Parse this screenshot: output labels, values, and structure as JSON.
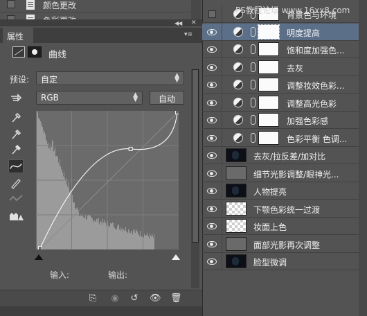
{
  "history": {
    "items": [
      {
        "label": "颜色更改"
      },
      {
        "label": "色彩更改"
      }
    ]
  },
  "properties": {
    "tab_label": "属性",
    "adjustment_title": "曲线",
    "preset_label": "预设:",
    "preset_value": "自定",
    "channel_value": "RGB",
    "auto_button": "自动",
    "input_label": "输入:",
    "output_label": "输出:"
  },
  "curve": {
    "control_points_normalized": [
      [
        0,
        0
      ],
      [
        0.66,
        0.73
      ],
      [
        1,
        1
      ]
    ],
    "histogram_note": "dark-heavy histogram"
  },
  "layers": {
    "watermark": "PS教程论坛 www.16xx8.com",
    "items": [
      {
        "name": "背景色与环境",
        "visible": false,
        "type": "adjustment"
      },
      {
        "name": "明度提高",
        "visible": true,
        "type": "adjustment",
        "selected": true
      },
      {
        "name": "饱和度加强色...",
        "visible": true,
        "type": "adjustment"
      },
      {
        "name": "去灰",
        "visible": true,
        "type": "adjustment"
      },
      {
        "name": "调整妆效色彩...",
        "visible": true,
        "type": "adjustment"
      },
      {
        "name": "调整高光色彩",
        "visible": true,
        "type": "adjustment"
      },
      {
        "name": "加强色彩感",
        "visible": true,
        "type": "adjustment"
      },
      {
        "name": "色彩平衡 色调...",
        "visible": true,
        "type": "adjustment"
      },
      {
        "name": "去灰/拉反差/加对比",
        "visible": true,
        "type": "image-dark"
      },
      {
        "name": "细节光影调整/眼神光...",
        "visible": true,
        "type": "image-gray"
      },
      {
        "name": "人物提亮",
        "visible": true,
        "type": "image-dark"
      },
      {
        "name": "下颚色彩统一过渡",
        "visible": true,
        "type": "image-checker"
      },
      {
        "name": "妆面上色",
        "visible": true,
        "type": "image-checker"
      },
      {
        "name": "面部光影再次调整",
        "visible": true,
        "type": "image-gray"
      },
      {
        "name": "脸型微调",
        "visible": true,
        "type": "image-dark"
      }
    ]
  },
  "colors": {
    "panel_bg": "#535353",
    "selected_layer": "#5b6f89",
    "curve_bg": "#6b6b6b"
  }
}
